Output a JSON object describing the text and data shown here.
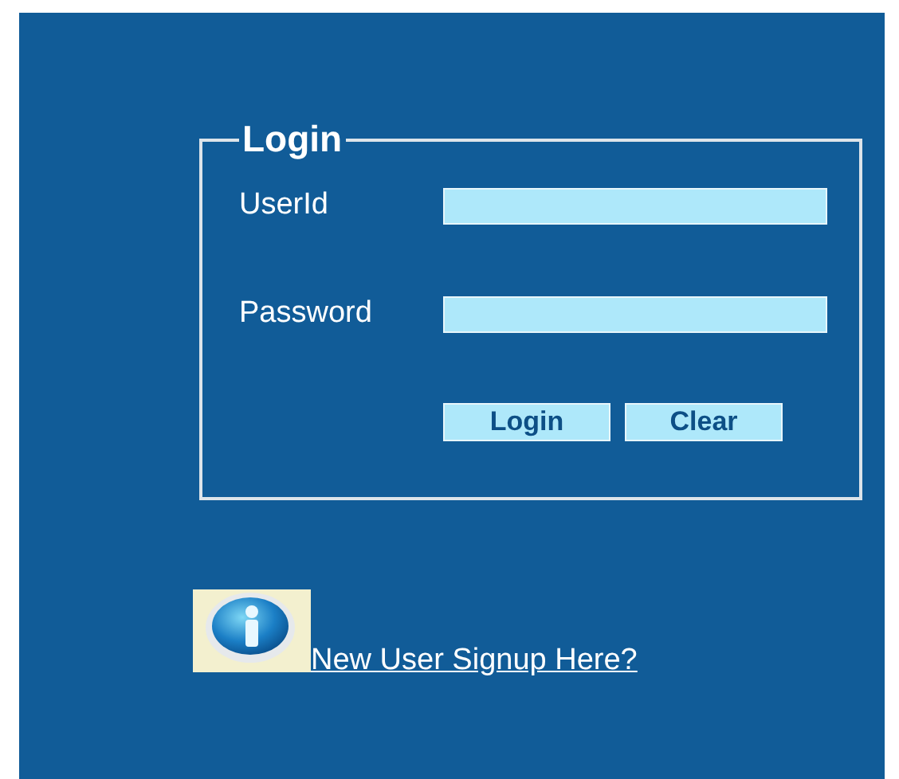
{
  "login_box": {
    "title": "Login",
    "fields": [
      {
        "label": "UserId"
      },
      {
        "label": "Password"
      }
    ],
    "buttons": [
      "Login",
      "Clear"
    ]
  },
  "signup_link": "New User Signup Here?"
}
